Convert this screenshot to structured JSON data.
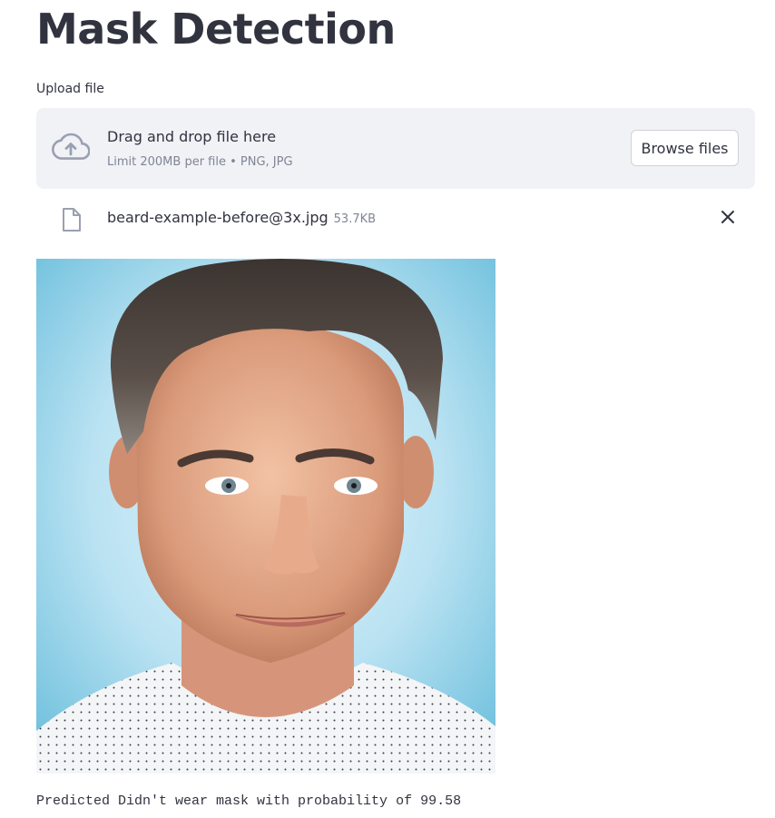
{
  "header": {
    "title": "Mask Detection"
  },
  "uploader": {
    "label": "Upload file",
    "drop_text": "Drag and drop file here",
    "limit_text": "Limit 200MB per file • PNG, JPG",
    "browse_label": "Browse files",
    "icon": "cloud-upload-icon"
  },
  "file": {
    "name": "beard-example-before@3x.jpg",
    "size": "53.7KB",
    "icon": "file-icon",
    "remove_icon": "close-icon"
  },
  "image": {
    "description_icon": "portrait-photo"
  },
  "result": {
    "text": "Predicted Didn't wear mask with probability of 99.58"
  }
}
